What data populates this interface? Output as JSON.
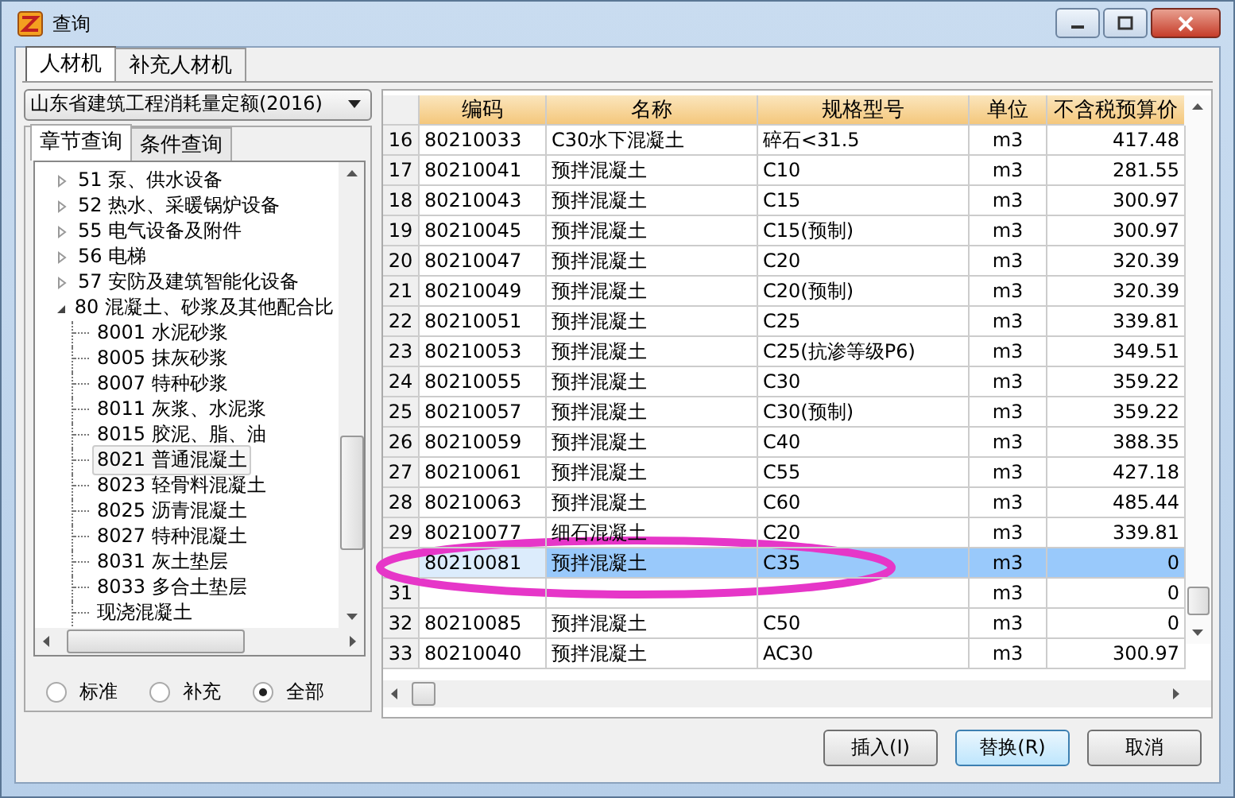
{
  "window": {
    "title": "查询"
  },
  "tabs": [
    {
      "label": "人材机",
      "selected": true
    },
    {
      "label": "补充人材机",
      "selected": false
    }
  ],
  "quota_dropdown": {
    "value": "山东省建筑工程消耗量定额(2016)"
  },
  "query_tabs": [
    {
      "label": "章节查询",
      "selected": true
    },
    {
      "label": "条件查询",
      "selected": false
    }
  ],
  "tree": [
    {
      "code": "51",
      "label": "泵、供水设备",
      "expanded": false,
      "selected": false
    },
    {
      "code": "52",
      "label": "热水、采暖锅炉设备",
      "expanded": false,
      "selected": false
    },
    {
      "code": "55",
      "label": "电气设备及附件",
      "expanded": false,
      "selected": false
    },
    {
      "code": "56",
      "label": "电梯",
      "expanded": false,
      "selected": false
    },
    {
      "code": "57",
      "label": "安防及建筑智能化设备",
      "expanded": false,
      "selected": false
    },
    {
      "code": "80",
      "label": "混凝土、砂浆及其他配合比",
      "expanded": true,
      "selected": false,
      "children": [
        {
          "code": "8001",
          "label": "水泥砂浆",
          "selected": false
        },
        {
          "code": "8005",
          "label": "抹灰砂浆",
          "selected": false
        },
        {
          "code": "8007",
          "label": "特种砂浆",
          "selected": false
        },
        {
          "code": "8011",
          "label": "灰浆、水泥浆",
          "selected": false
        },
        {
          "code": "8015",
          "label": "胶泥、脂、油",
          "selected": false
        },
        {
          "code": "8021",
          "label": "普通混凝土",
          "selected": true
        },
        {
          "code": "8023",
          "label": "轻骨料混凝土",
          "selected": false
        },
        {
          "code": "8025",
          "label": "沥青混凝土",
          "selected": false
        },
        {
          "code": "8027",
          "label": "特种混凝土",
          "selected": false
        },
        {
          "code": "8031",
          "label": "灰土垫层",
          "selected": false
        },
        {
          "code": "8033",
          "label": "多合土垫层",
          "selected": false
        },
        {
          "label": "现浇混凝土",
          "selected": false
        }
      ]
    }
  ],
  "filter_radios": [
    {
      "label": "标准",
      "selected": false
    },
    {
      "label": "补充",
      "selected": false
    },
    {
      "label": "全部",
      "selected": true
    }
  ],
  "table": {
    "columns": [
      "编码",
      "名称",
      "规格型号",
      "单位",
      "不含税预算价"
    ],
    "rows": [
      {
        "num": "16",
        "code": "80210033",
        "name": "C30水下混凝土",
        "spec": "碎石<31.5",
        "unit": "m3",
        "price": "417.48",
        "selected": false
      },
      {
        "num": "17",
        "code": "80210041",
        "name": "预拌混凝土",
        "spec": "C10",
        "unit": "m3",
        "price": "281.55",
        "selected": false
      },
      {
        "num": "18",
        "code": "80210043",
        "name": "预拌混凝土",
        "spec": "C15",
        "unit": "m3",
        "price": "300.97",
        "selected": false
      },
      {
        "num": "19",
        "code": "80210045",
        "name": "预拌混凝土",
        "spec": "C15(预制)",
        "unit": "m3",
        "price": "300.97",
        "selected": false
      },
      {
        "num": "20",
        "code": "80210047",
        "name": "预拌混凝土",
        "spec": "C20",
        "unit": "m3",
        "price": "320.39",
        "selected": false
      },
      {
        "num": "21",
        "code": "80210049",
        "name": "预拌混凝土",
        "spec": "C20(预制)",
        "unit": "m3",
        "price": "320.39",
        "selected": false
      },
      {
        "num": "22",
        "code": "80210051",
        "name": "预拌混凝土",
        "spec": "C25",
        "unit": "m3",
        "price": "339.81",
        "selected": false
      },
      {
        "num": "23",
        "code": "80210053",
        "name": "预拌混凝土",
        "spec": "C25(抗渗等级P6)",
        "unit": "m3",
        "price": "349.51",
        "selected": false
      },
      {
        "num": "24",
        "code": "80210055",
        "name": "预拌混凝土",
        "spec": "C30",
        "unit": "m3",
        "price": "359.22",
        "selected": false
      },
      {
        "num": "25",
        "code": "80210057",
        "name": "预拌混凝土",
        "spec": "C30(预制)",
        "unit": "m3",
        "price": "359.22",
        "selected": false
      },
      {
        "num": "26",
        "code": "80210059",
        "name": "预拌混凝土",
        "spec": "C40",
        "unit": "m3",
        "price": "388.35",
        "selected": false
      },
      {
        "num": "27",
        "code": "80210061",
        "name": "预拌混凝土",
        "spec": "C55",
        "unit": "m3",
        "price": "427.18",
        "selected": false
      },
      {
        "num": "28",
        "code": "80210063",
        "name": "预拌混凝土",
        "spec": "C60",
        "unit": "m3",
        "price": "485.44",
        "selected": false
      },
      {
        "num": "29",
        "code": "80210077",
        "name": "细石混凝土",
        "spec": "C20",
        "unit": "m3",
        "price": "339.81",
        "selected": false
      },
      {
        "code": "80210081",
        "name": "预拌混凝土",
        "spec": "C35",
        "unit": "m3",
        "price": "0",
        "selected": true
      },
      {
        "num": "31",
        "unit": "m3",
        "price": "0",
        "selected": false
      },
      {
        "num": "32",
        "code": "80210085",
        "name": "预拌混凝土",
        "spec": "C50",
        "unit": "m3",
        "price": "0",
        "selected": false
      },
      {
        "num": "33",
        "code": "80210040",
        "name": "预拌混凝土",
        "spec": "AC30",
        "unit": "m3",
        "price": "300.97",
        "selected": false
      }
    ]
  },
  "buttons": [
    {
      "label": "插入(I)",
      "default": false
    },
    {
      "label": "替换(R)",
      "default": true
    },
    {
      "label": "取消",
      "default": false
    }
  ]
}
